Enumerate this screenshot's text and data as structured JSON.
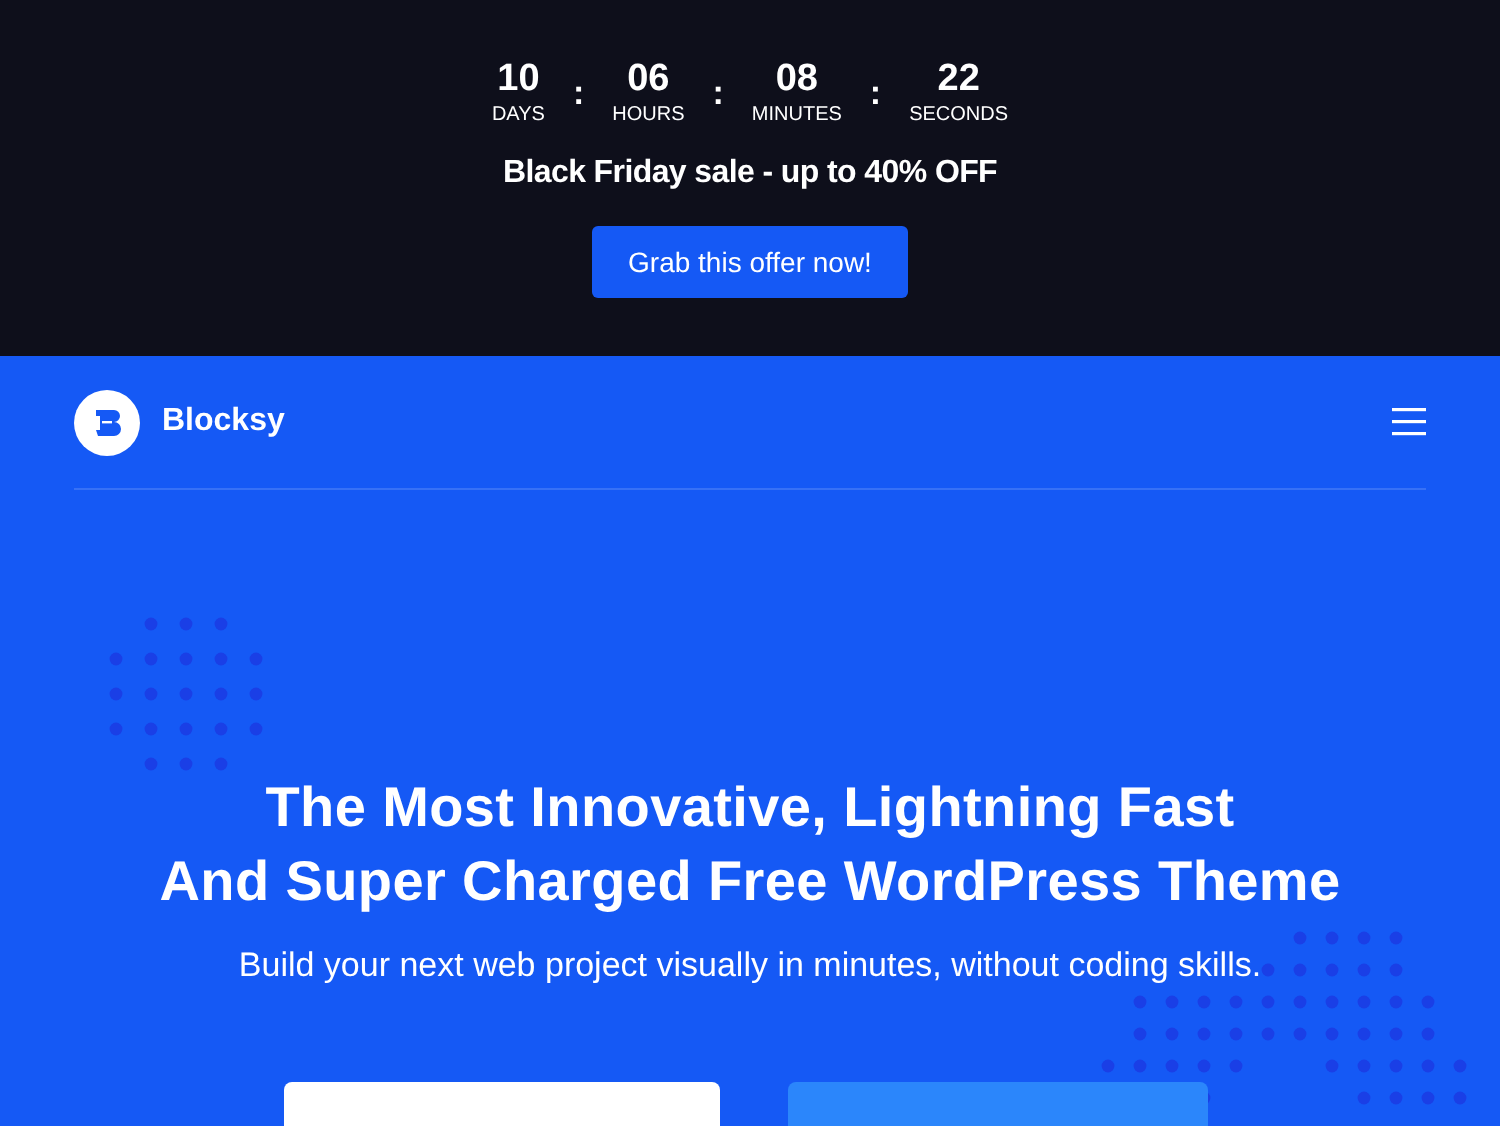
{
  "promo": {
    "countdown": [
      {
        "value": "10",
        "unit": "DAYS"
      },
      {
        "value": "06",
        "unit": "HOURS"
      },
      {
        "value": "08",
        "unit": "MINUTES"
      },
      {
        "value": "22",
        "unit": "SECONDS"
      }
    ],
    "separator": ":",
    "headline": "Black Friday sale - up to 40% OFF",
    "button": "Grab this offer now!"
  },
  "header": {
    "brand": "Blocksy"
  },
  "hero": {
    "title_lines": [
      "The Most Innovative, Lightning Fast",
      "And Super Charged Free WordPress Theme"
    ],
    "subtitle": "Build your next web project visually in minutes, without coding skills."
  }
}
